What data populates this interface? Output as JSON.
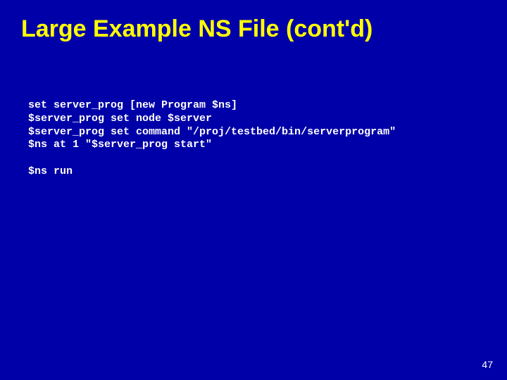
{
  "title": "Large Example NS File (cont'd)",
  "code": {
    "line1": "set server_prog [new Program $ns]",
    "line2": "$server_prog set node $server",
    "line3": "$server_prog set command \"/proj/testbed/bin/serverprogram\"",
    "line4": "$ns at 1 \"$server_prog start\"",
    "line5": "",
    "line6": "$ns run"
  },
  "page_number": "47"
}
